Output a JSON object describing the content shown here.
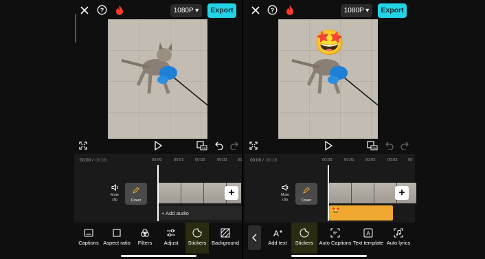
{
  "left": {
    "resolution": "1080P",
    "export_label": "Export",
    "current_time": "00:00",
    "separator": "/",
    "total_time": "00:18",
    "ticks": [
      "00:00",
      "00:01",
      "00:02",
      "00:03",
      "00"
    ],
    "mute_label": "Mute clip",
    "cover_label": "Cover",
    "add_audio_label": "+ Add audio",
    "tools": [
      {
        "label": "Captions",
        "icon": "captions-icon"
      },
      {
        "label": "Aspect ratio",
        "icon": "aspect-ratio-icon"
      },
      {
        "label": "Filters",
        "icon": "filters-icon"
      },
      {
        "label": "Adjust",
        "icon": "adjust-icon"
      },
      {
        "label": "Stickers",
        "icon": "stickers-icon",
        "selected": true
      },
      {
        "label": "Background",
        "icon": "background-icon"
      }
    ]
  },
  "right": {
    "resolution": "1080P",
    "export_label": "Export",
    "current_time": "00:00",
    "separator": "/",
    "total_time": "00:18",
    "ticks": [
      "00:00",
      "00:01",
      "00:02",
      "00:03",
      "00"
    ],
    "mute_label": "Mute clip",
    "cover_label": "Cover",
    "sticker_emoji": "🤩",
    "tools": [
      {
        "label": "Add text",
        "icon": "add-text-icon"
      },
      {
        "label": "Stickers",
        "icon": "stickers-icon",
        "selected": true
      },
      {
        "label": "Auto Captions",
        "icon": "auto-captions-icon"
      },
      {
        "label": "Text template",
        "icon": "text-template-icon"
      },
      {
        "label": "Auto lyrics",
        "icon": "auto-lyrics-icon"
      }
    ]
  },
  "colors": {
    "accent": "#22d3e6",
    "sticker_track": "#f0a830",
    "highlight": "#2b2b11"
  }
}
